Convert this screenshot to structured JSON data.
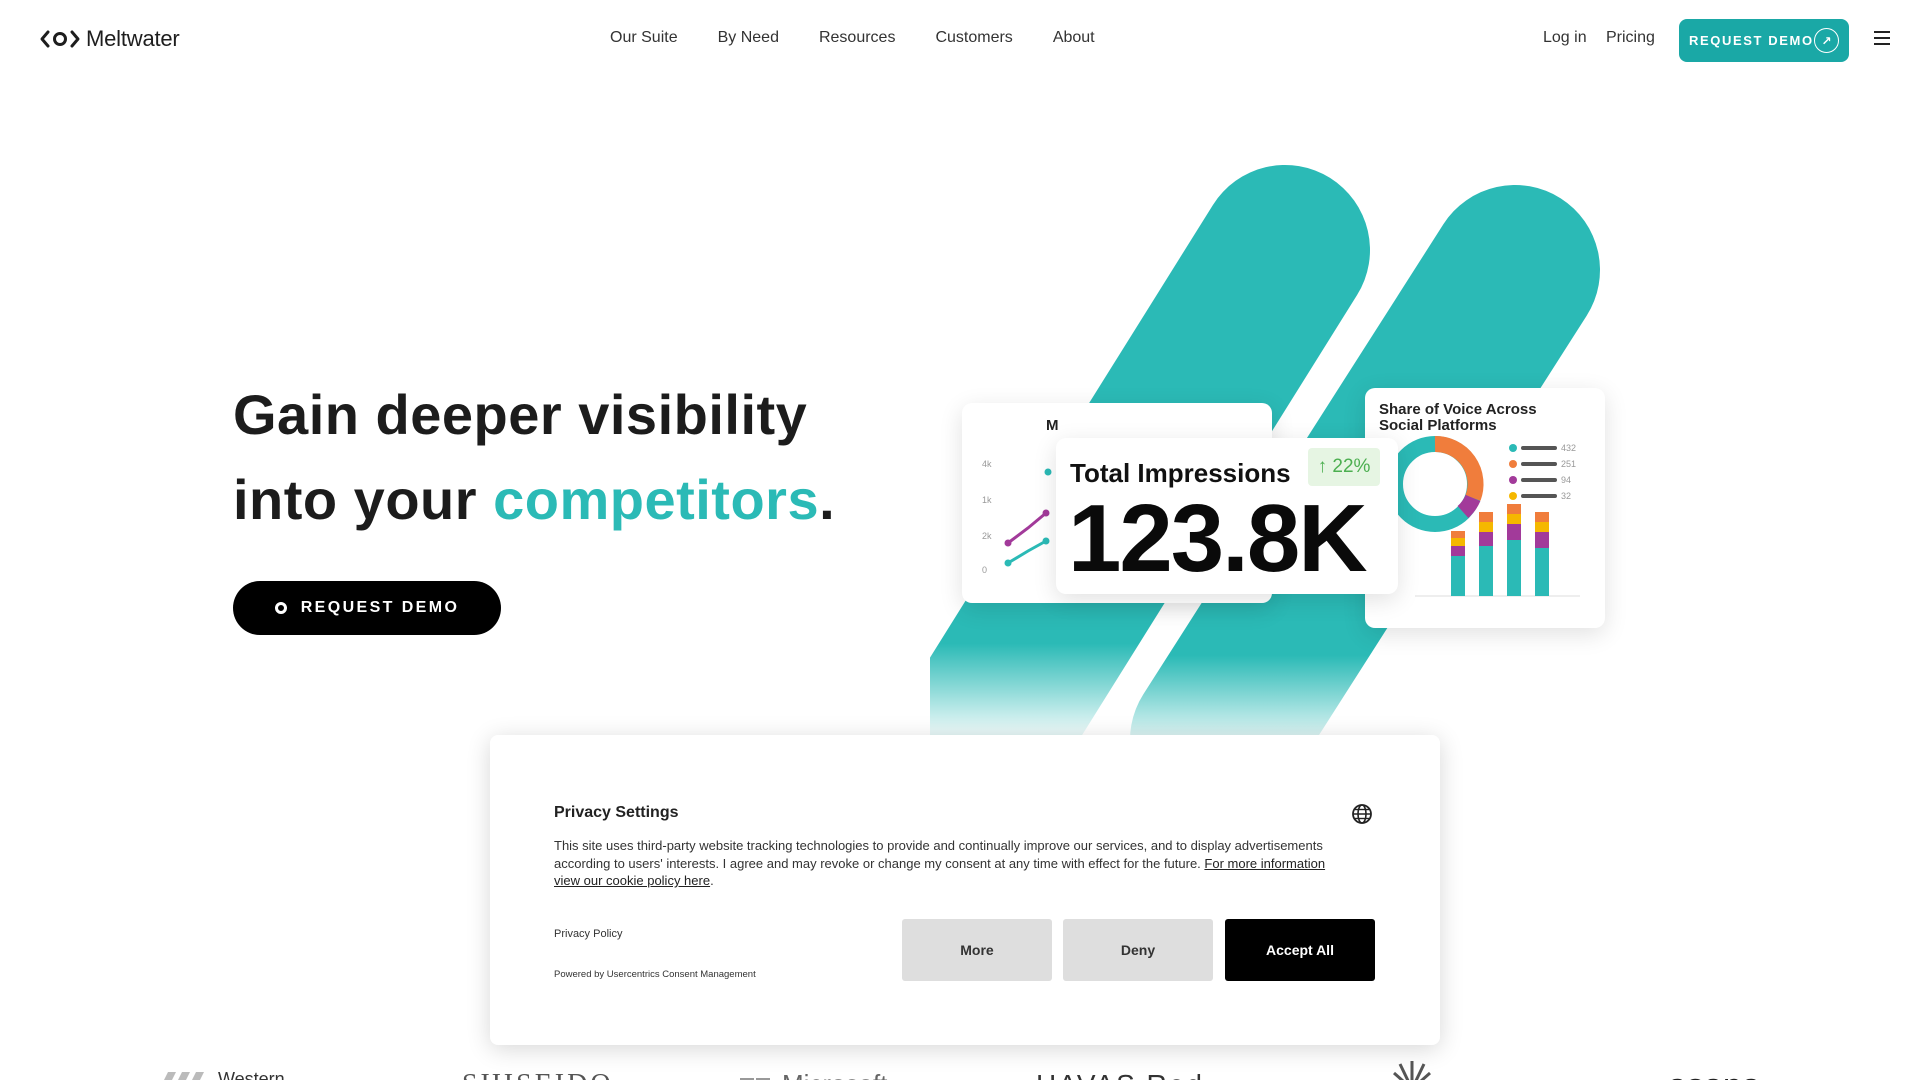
{
  "header": {
    "logo_text": "Meltwater",
    "nav": [
      "Our Suite",
      "By Need",
      "Resources",
      "Customers",
      "About"
    ],
    "login": "Log in",
    "pricing": "Pricing",
    "demo_label": "REQUEST DEMO",
    "demo_icon": "arrow-up-right-icon",
    "menu_icon": "hamburger-icon"
  },
  "hero": {
    "title_line1": "Gain deeper visibility",
    "title_line2_prefix": "into your ",
    "title_accent": "competitors",
    "title_suffix": ".",
    "cta_label": "REQUEST DEMO",
    "accent_color": "#2bbab6"
  },
  "graphic": {
    "total_impressions_label": "Total Impressions",
    "total_impressions_value": "123.8K",
    "change_badge": "↑ 22%",
    "share_of_voice_title": "Share of Voice Across Social Platforms",
    "legend_values": [
      "432",
      "251",
      "94",
      "32"
    ],
    "partial_card_label": "M",
    "shape_color": "#2bbab6"
  },
  "consent": {
    "title": "Privacy Settings",
    "body": "This site uses third-party website tracking technologies to provide and continually improve our services, and to display advertisements according to users' interests. I agree and may revoke or change my consent at any time with effect for the future.",
    "link": "For more information view our cookie policy here",
    "link_suffix": ".",
    "privacy_policy": "Privacy Policy",
    "powered_by": "Powered by Usercentrics Consent Management",
    "btn_more": "More",
    "btn_deny": "Deny",
    "btn_accept": "Accept All"
  },
  "logos": [
    "Western",
    "SHISEIDO",
    "Microsoft",
    "HAVAS Red",
    "asana"
  ]
}
